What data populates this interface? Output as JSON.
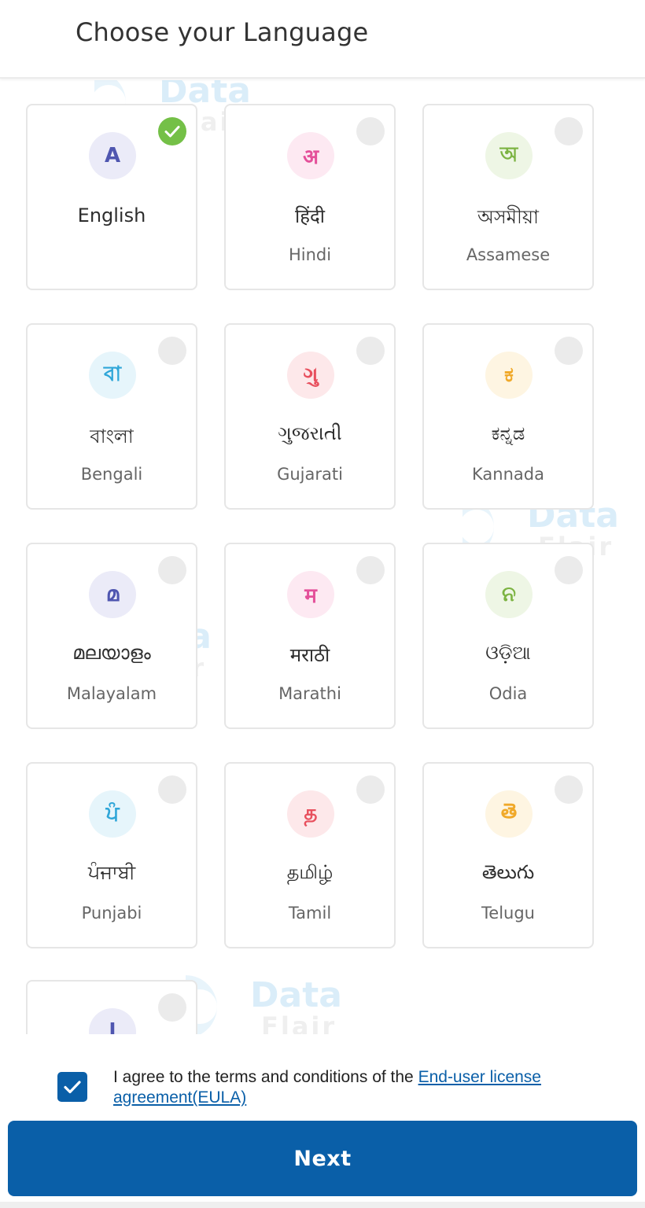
{
  "header": {
    "title": "Choose your Language"
  },
  "watermark": {
    "line1": "Data",
    "line2": "Flair"
  },
  "languages": [
    {
      "native": "English",
      "english": "",
      "glyph": "A",
      "glyph_color": "#4f56b0",
      "glyph_bg": "#ebebf8",
      "selected": true
    },
    {
      "native": "हिंदी",
      "english": "Hindi",
      "glyph": "अ",
      "glyph_color": "#e4509a",
      "glyph_bg": "#fde9f2",
      "selected": false
    },
    {
      "native": "অসমীয়া",
      "english": "Assamese",
      "glyph": "অ",
      "glyph_color": "#7cb342",
      "glyph_bg": "#eef6e5",
      "selected": false
    },
    {
      "native": "বাংলা",
      "english": "Bengali",
      "glyph": "বা",
      "glyph_color": "#2fa6d8",
      "glyph_bg": "#e6f5fb",
      "selected": false
    },
    {
      "native": "ગુજરાતી",
      "english": "Gujarati",
      "glyph": "ગુ",
      "glyph_color": "#e8505e",
      "glyph_bg": "#fde8ea",
      "selected": false
    },
    {
      "native": "ಕನ್ನಡ",
      "english": "Kannada",
      "glyph": "ಕ",
      "glyph_color": "#f0a92a",
      "glyph_bg": "#fef5e2",
      "selected": false
    },
    {
      "native": "മലയാളം",
      "english": "Malayalam",
      "glyph": "മ",
      "glyph_color": "#4f56b0",
      "glyph_bg": "#ebebf8",
      "selected": false
    },
    {
      "native": "मराठी",
      "english": "Marathi",
      "glyph": "म",
      "glyph_color": "#e4509a",
      "glyph_bg": "#fde9f2",
      "selected": false
    },
    {
      "native": "ଓଡ଼ିଆ",
      "english": "Odia",
      "glyph": "ନ",
      "glyph_color": "#7cb342",
      "glyph_bg": "#eef6e5",
      "selected": false
    },
    {
      "native": "ਪੰਜਾਬੀ",
      "english": "Punjabi",
      "glyph": "ਪੰ",
      "glyph_color": "#2fa6d8",
      "glyph_bg": "#e6f5fb",
      "selected": false
    },
    {
      "native": "தமிழ்",
      "english": "Tamil",
      "glyph": "த",
      "glyph_color": "#e8505e",
      "glyph_bg": "#fde8ea",
      "selected": false
    },
    {
      "native": "తెలుగు",
      "english": "Telugu",
      "glyph": "తె",
      "glyph_color": "#f0a92a",
      "glyph_bg": "#fef5e2",
      "selected": false
    },
    {
      "native": "",
      "english": "",
      "glyph": "ا",
      "glyph_color": "#4f56b0",
      "glyph_bg": "#ebebf8",
      "selected": false
    }
  ],
  "agreement": {
    "checked": true,
    "text": "I agree to the terms and conditions of the ",
    "link": "End-user license agreement(EULA)"
  },
  "next_button": {
    "label": "Next"
  },
  "colors": {
    "primary": "#0a5fa8",
    "selected_check": "#74c047",
    "card_border": "#e6e6e6"
  }
}
